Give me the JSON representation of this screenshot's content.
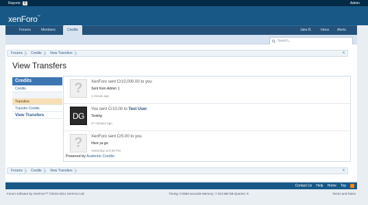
{
  "admin_bar": {
    "reports_label": "Reports:",
    "reports_count": "0",
    "admin_label": "Admin"
  },
  "logo": {
    "text": "xenForo",
    "tm": "™"
  },
  "nav": {
    "tabs": [
      "Forums",
      "Members",
      "Credits"
    ],
    "right": [
      "Jake B.",
      "Inbox",
      "Alerts"
    ]
  },
  "search": {
    "placeholder": "Search..."
  },
  "breadcrumb": {
    "items": [
      "Forums",
      "Credits",
      "View Transfers"
    ]
  },
  "page_title": "View Transfers",
  "sidebar": {
    "header": "Credits",
    "items": [
      {
        "label": "Credits"
      },
      {
        "label": "Transfers"
      },
      {
        "label": "Transfer Credits"
      },
      {
        "label": "View Transfers"
      }
    ]
  },
  "transfers": [
    {
      "avatar": "?",
      "message": "XenForo sent Cr10,000.00 to you",
      "note": "Sent from Admin :)",
      "time": "1 minute ago"
    },
    {
      "avatar": "DG",
      "message_pre": "You sent Cr10.00 to",
      "recipient": "Test User",
      "note": "Testing",
      "time": "47 minutes ago"
    },
    {
      "avatar": "?",
      "message": "XenForo sent Cr5.00 to you",
      "note": "Here ya go.",
      "time": "Yesterday at 8:30 PM"
    }
  ],
  "powered": {
    "prefix": "Powered by",
    "link": "Audentio Credits"
  },
  "footer": {
    "links": [
      "Contact Us",
      "Help",
      "Home",
      "Top"
    ]
  },
  "legal": {
    "left": "Forum software by XenForo™ ©2010-2014 XenForo Ltd.",
    "timing": "Timing: 0.0560 seconds Memory: 7.313 MB DB Queries: 8",
    "right": "Terms and Rules"
  },
  "colors": {
    "header": "#185886",
    "adminbar": "#032a46",
    "sidebar_header": "#3d76b2",
    "active_item": "#f6dfb8"
  }
}
